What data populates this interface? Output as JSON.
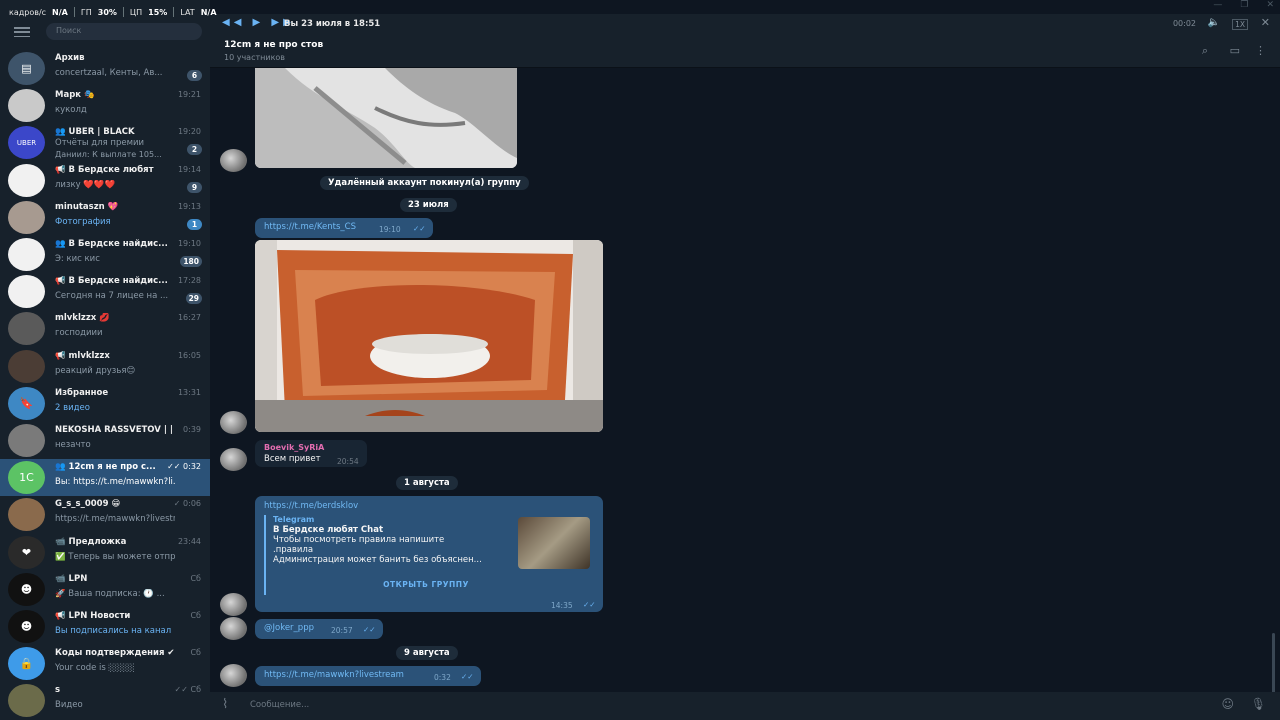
{
  "stats": {
    "fps_label": "кадров/с",
    "fps_value": "N/A",
    "gpu_label": "ГП",
    "gpu_value": "30%",
    "cpu_label": "ЦП",
    "cpu_value": "15%",
    "lat_label": "LAT",
    "lat_value": "N/A"
  },
  "sidebar": {
    "search_placeholder": "Поиск",
    "chats": [
      {
        "name": "Архив",
        "preview": "concertzaal, Кенты, Ав...",
        "time": "",
        "badge": "6",
        "badge_style": "grey",
        "avatar_color": "#3e546a",
        "avatar_text": "▤"
      },
      {
        "name": "Марк 🎭",
        "preview": "куколд",
        "time": "19:21",
        "badge": "",
        "avatar_color": "#c9c9c9",
        "avatar_text": ""
      },
      {
        "name": "👥 UBER | BLACK",
        "preview": "Отчёты для премии",
        "preview2": "Даниил: К выплате 105...",
        "time": "19:20",
        "badge": "2",
        "badge_style": "grey",
        "avatar_color": "#3b47c9",
        "avatar_text": "UBER"
      },
      {
        "name": "📢 В Бердске любят",
        "preview": "лизку ❤️❤️❤️",
        "time": "19:14",
        "badge": "9",
        "badge_style": "grey",
        "avatar_color": "#f1f1f1",
        "avatar_text": ""
      },
      {
        "name": "minutaszn 💖",
        "preview": "Фотография",
        "time": "19:13",
        "badge": "1",
        "badge_style": "blue",
        "avatar_color": "#a79a90",
        "avatar_text": ""
      },
      {
        "name": "👥 В Бердске найдис...",
        "preview": "Э: кис кис",
        "time": "19:10",
        "badge": "180",
        "badge_style": "grey",
        "avatar_color": "#f1f1f1",
        "avatar_text": ""
      },
      {
        "name": "📢 В Бердске найдис...",
        "preview": "Сегодня на 7 лицее на ...",
        "time": "17:28",
        "badge": "29",
        "badge_style": "grey",
        "avatar_color": "#f1f1f1",
        "avatar_text": ""
      },
      {
        "name": "mlvklzzx 💋",
        "preview": "господиии",
        "time": "16:27",
        "badge": "",
        "avatar_color": "#5a5a5a",
        "avatar_text": ""
      },
      {
        "name": "📢 mlvklzzx",
        "preview": "реакций друзья😊",
        "time": "16:05",
        "badge": "",
        "avatar_color": "#4b3d35",
        "avatar_text": ""
      },
      {
        "name": "Избранное",
        "preview": "2 видео",
        "time": "13:31",
        "badge": "",
        "avatar_color": "#3e88c4",
        "avatar_text": "🔖"
      },
      {
        "name": "NEKOSHA RASSVETOV | | ...",
        "preview": "незачто",
        "time": "0:39",
        "badge": "",
        "avatar_color": "#7a7a7a",
        "avatar_text": ""
      },
      {
        "name": "👥 12cm я не про с...",
        "preview": "Вы: https://t.me/mawwkn?li...",
        "time": "✓✓ 0:32",
        "badge": "",
        "avatar_color": "#5cc365",
        "avatar_text": "1C",
        "active": true
      },
      {
        "name": "G_s_s_0009 😁",
        "preview": "https://t.me/mawwkn?livestr...",
        "time": "✓ 0:06",
        "badge": "",
        "avatar_color": "#8a6a4c",
        "avatar_text": ""
      },
      {
        "name": "📹 Предложка",
        "preview": "✅ Теперь вы можете отпр...",
        "time": "23:44",
        "badge": "",
        "avatar_color": "#2a2a2a",
        "avatar_text": "❤"
      },
      {
        "name": "📹 LPN",
        "preview": "🚀 Ваша подписка: 🕐 ...",
        "time": "Сб",
        "badge": "",
        "avatar_color": "#111111",
        "avatar_text": "☻"
      },
      {
        "name": "📢 LPN Новости",
        "preview": "Вы подписались на канал",
        "time": "Сб",
        "badge": "",
        "avatar_color": "#111111",
        "avatar_text": "☻"
      },
      {
        "name": "Коды подтверждения ✔",
        "preview": "Your code is ░░░░",
        "time": "Сб",
        "badge": "",
        "avatar_color": "#3e9be9",
        "avatar_text": "🔒"
      },
      {
        "name": "s",
        "preview": "Видео",
        "time": "✓✓ Сб",
        "badge": "",
        "avatar_color": "#6b6b4a",
        "avatar_text": ""
      }
    ]
  },
  "player": {
    "now_playing": "Вы 23 июля в 18:51",
    "duration": "00:02",
    "speed": "1X"
  },
  "chat_header": {
    "title": "12cm я не про стов",
    "subtitle": "10 участников"
  },
  "messages": {
    "service_left": "Удалённый аккаунт покинул(а) группу",
    "date_1": "23 июля",
    "link_1": "https://t.me/Kents_CS",
    "link_1_time": "19:10",
    "sender": "Boevik_SyRiA",
    "greeting": "Всем привет",
    "greeting_time": "20:54",
    "date_2": "1 августа",
    "link_2": "https://t.me/berdsklov",
    "preview_site": "Telegram",
    "preview_title": "В Бердске любят Chat",
    "preview_line1": "Чтобы посмотреть правила напишите",
    "preview_line2": ".правила",
    "preview_line3": "Администрация может банить без объяснен...",
    "preview_button": "ОТКРЫТЬ ГРУППУ",
    "link_2_time": "14:35",
    "mention": "@Joker_ppp",
    "mention_time": "20:57",
    "date_3": "9 августа",
    "link_3": "https://t.me/mawwkn?livestream",
    "link_3_time": "0:32"
  },
  "input": {
    "placeholder": "Сообщение..."
  },
  "colors": {
    "sidebar_bg": "#17212b",
    "chat_bg": "#0e1621",
    "outgoing_bubble": "#2b5278",
    "active_chat": "#2b5278",
    "link": "#71baf5"
  }
}
